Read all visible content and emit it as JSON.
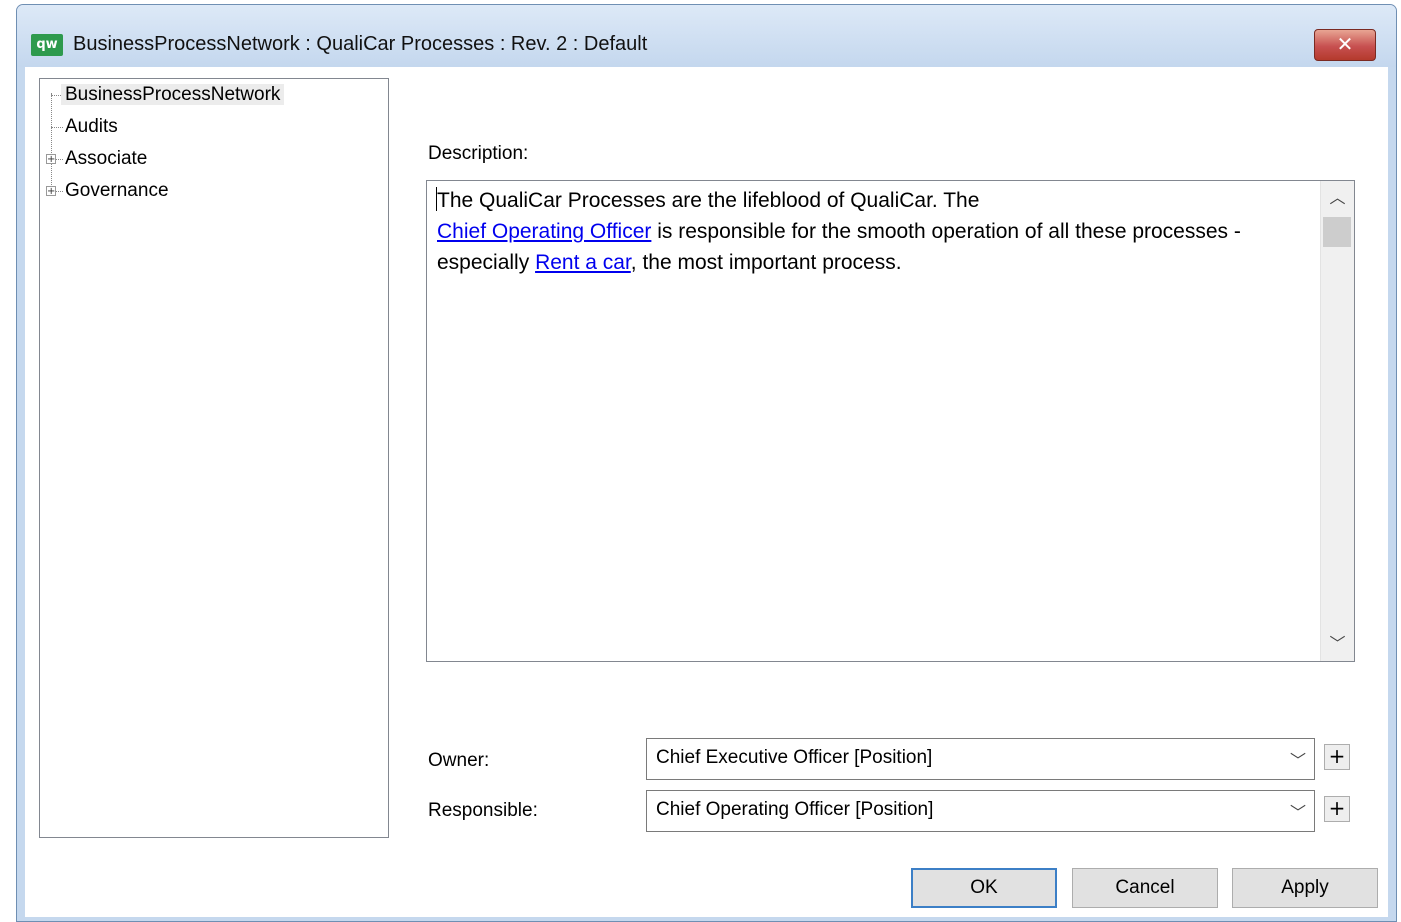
{
  "window": {
    "app_icon_text": "qw",
    "title": "BusinessProcessNetwork : QualiCar Processes : Rev. 2  : Default",
    "close_glyph": "✕"
  },
  "tree": {
    "items": [
      {
        "label": "BusinessProcessNetwork",
        "selected": true,
        "expandable": false
      },
      {
        "label": "Audits",
        "selected": false,
        "expandable": false
      },
      {
        "label": "Associate",
        "selected": false,
        "expandable": true
      },
      {
        "label": "Governance",
        "selected": false,
        "expandable": true
      }
    ],
    "expander_glyph": "+"
  },
  "description": {
    "label": "Description:",
    "text_part1": "The QualiCar Processes are the lifeblood of QualiCar. The",
    "link1": "Chief Operating Officer",
    "text_part2": " is responsible for the smooth operation of all  these processes - especially ",
    "link2": "Rent a car",
    "text_part3": ", the most important process.",
    "scroll_up_glyph": "︿",
    "scroll_down_glyph": "﹀"
  },
  "fields": {
    "owner_label": "Owner:",
    "owner_value": "Chief Executive Officer [Position]",
    "responsible_label": "Responsible:",
    "responsible_value": "Chief Operating Officer [Position]",
    "dropdown_glyph": "﹀",
    "add_glyph": "+"
  },
  "buttons": {
    "ok": "OK",
    "cancel": "Cancel",
    "apply": "Apply"
  },
  "colors": {
    "link": "#0000ee",
    "title_bar": "#c4d7ee",
    "close": "#c75050"
  }
}
